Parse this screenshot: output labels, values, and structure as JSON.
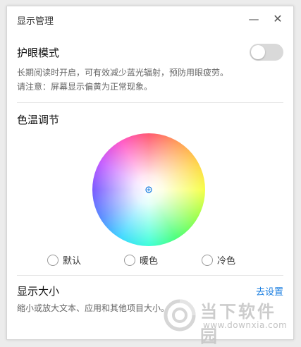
{
  "window": {
    "title": "显示管理",
    "minimize_glyph": "—",
    "close_glyph": "✕"
  },
  "eye_care": {
    "title": "护眼模式",
    "desc_line1": "长期阅读时开启，可有效减少蓝光辐射，预防用眼疲劳。",
    "desc_line2": "请注意：屏幕显示偏黄为正常现象。",
    "toggle_on": false
  },
  "color_temp": {
    "title": "色温调节",
    "options": [
      {
        "label": "默认",
        "selected": false
      },
      {
        "label": "暖色",
        "selected": false
      },
      {
        "label": "冷色",
        "selected": false
      }
    ]
  },
  "display_size": {
    "title": "显示大小",
    "link": "去设置",
    "desc": "缩小或放大文本、应用和其他项目大小。"
  },
  "watermark": {
    "brand": "当下软件园",
    "url": "www.downxia.com"
  },
  "colors": {
    "accent": "#1a7ee0",
    "toggle_off": "#d9d9d9"
  }
}
